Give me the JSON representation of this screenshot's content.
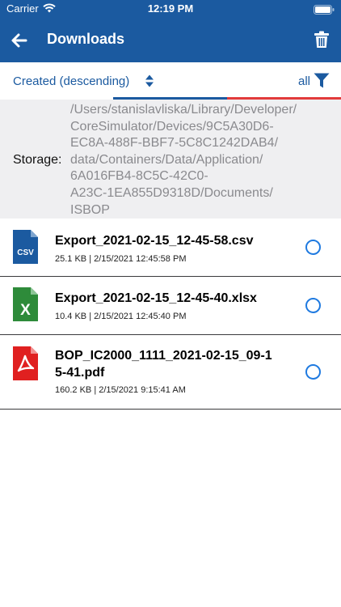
{
  "status": {
    "carrier": "Carrier",
    "time": "12:19 PM"
  },
  "nav": {
    "title": "Downloads"
  },
  "sort": {
    "label": "Created (descending)",
    "filter": "all"
  },
  "storage": {
    "label": "Storage:",
    "path_lines": [
      "/Users/stanislavliska/Library/Developer/",
      "CoreSimulator/Devices/9C5A30D6-",
      "EC8A-488F-BBF7-5C8C1242DAB4/",
      "data/Containers/Data/Application/",
      "6A016FB4-8C5C-42C0-",
      "A23C-1EA855D9318D/Documents/",
      "ISBOP"
    ]
  },
  "files": [
    {
      "name": "Export_2021-02-15_12-45-58.csv",
      "meta": "25.1 KB  |  2/15/2021 12:45:58 PM",
      "icon": "csv-file-icon",
      "color": "#1b5aa0"
    },
    {
      "name": "Export_2021-02-15_12-45-40.xlsx",
      "meta": "10.4 KB  |  2/15/2021 12:45:40 PM",
      "icon": "excel-file-icon",
      "color": "#2e8b3a"
    },
    {
      "name": "BOP_IC2000_1111_2021-02-15_09-15-41.pdf",
      "name_line1": "BOP_IC2000_1111_2021-02-15_09-1",
      "name_line2": "5-41.pdf",
      "meta": "160.2 KB  |  2/15/2021 9:15:41 AM",
      "icon": "pdf-file-icon",
      "color": "#e02020"
    }
  ],
  "colors": {
    "header": "#1b5aa0",
    "accent": "#1f7ae0",
    "tab_red": "#e23b3b"
  }
}
